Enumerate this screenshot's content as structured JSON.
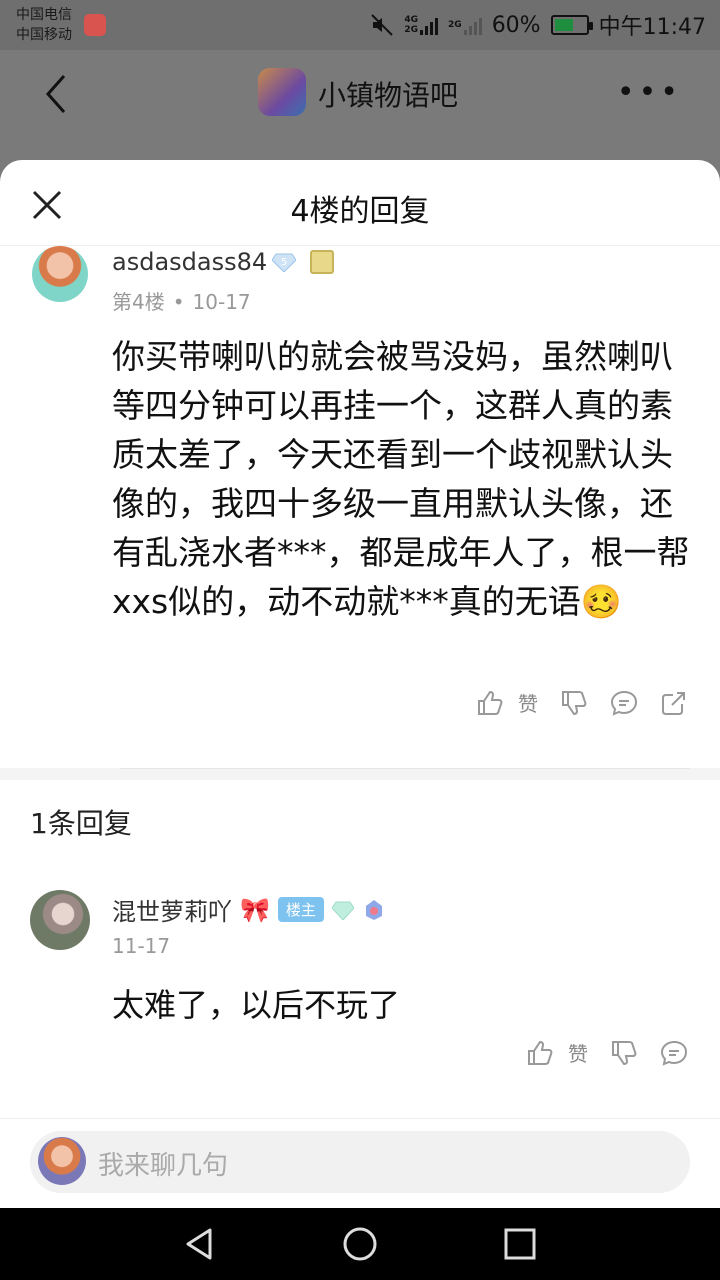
{
  "statusbar": {
    "carrier1": "中国电信",
    "carrier2": "中国移动",
    "net_top": "4G",
    "net_bottom": "2G",
    "net2": "2G",
    "battery": "60%",
    "time": "中午11:47"
  },
  "header": {
    "title": "小镇物语吧"
  },
  "sheet": {
    "title": "4楼的回复"
  },
  "post": {
    "username": "asdasdass84",
    "level": "5",
    "floor": "第4楼",
    "dot": "•",
    "date": "10-17",
    "content": "你买带喇叭的就会被骂没妈，虽然喇叭等四分钟可以再挂一个，这群人真的素质太差了，今天还看到一个歧视默认头像的，我四十多级一直用默认头像，还有乱浇水者***，都是成年人了，根一帮xxs似的，动不动就***真的无语🥴",
    "like_label": "赞"
  },
  "replies": {
    "count_text": "1条回复",
    "items": [
      {
        "name": "混世萝莉吖",
        "bow": "🎀",
        "owner_badge": "楼主",
        "date": "11-17",
        "text": "太难了，以后不玩了",
        "like_label": "赞"
      }
    ]
  },
  "input": {
    "placeholder": "我来聊几句"
  },
  "colors": {
    "accent_badge": "#7ec3ef",
    "dim_overlay": "#7a7a7a"
  }
}
